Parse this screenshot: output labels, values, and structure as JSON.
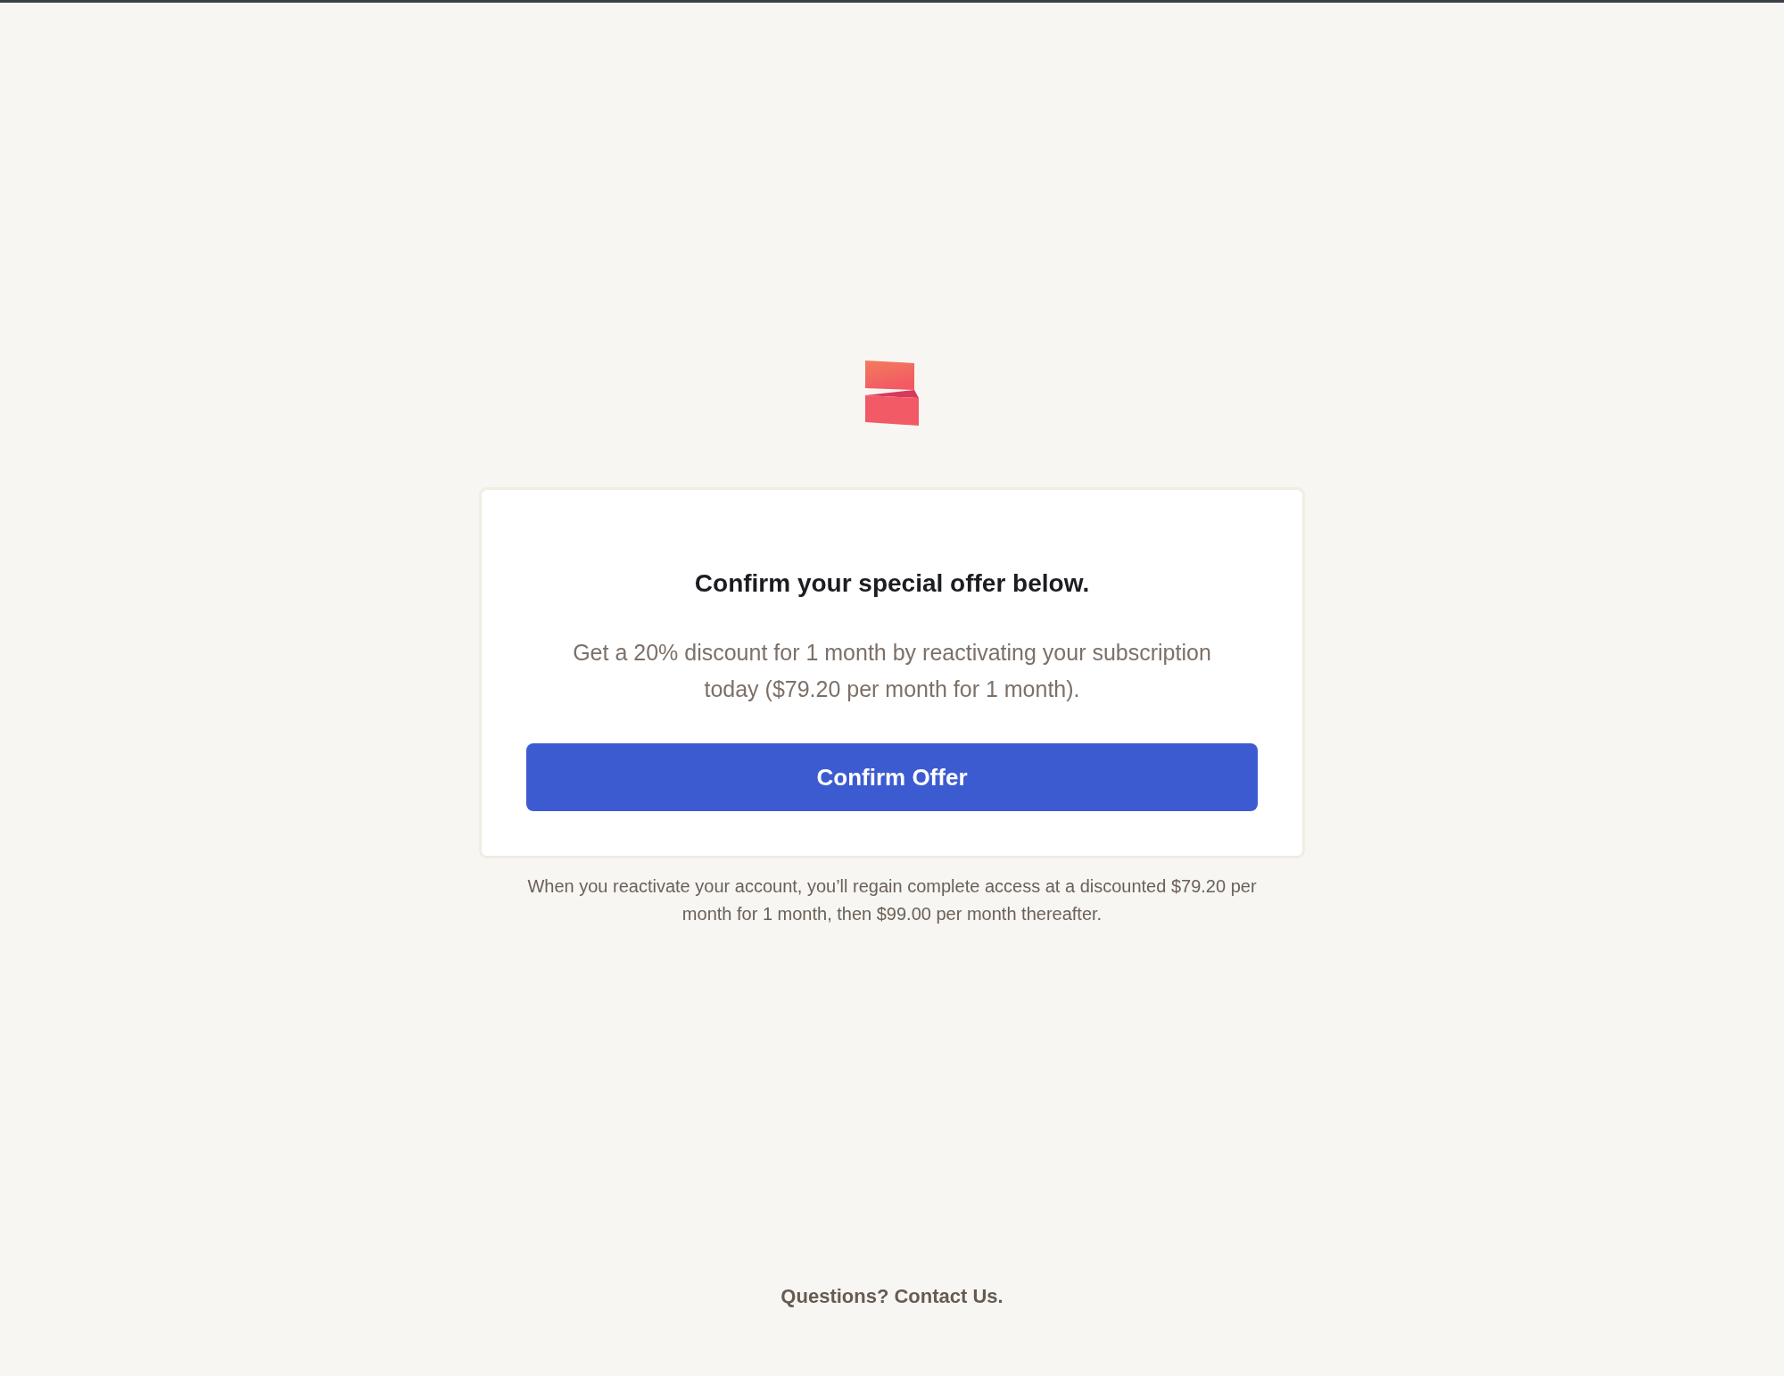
{
  "card": {
    "heading": "Confirm your special offer below.",
    "description": "Get a 20% discount for 1 month by reactivating your subscription today ($79.20 per month for 1 month).",
    "button": "Confirm Offer"
  },
  "note": "When you reactivate your account, you’ll regain complete access at a discounted $79.20 per month for 1 month, then $99.00 per month thereafter.",
  "footer": {
    "question": "Questions?",
    "link": "Contact Us."
  }
}
